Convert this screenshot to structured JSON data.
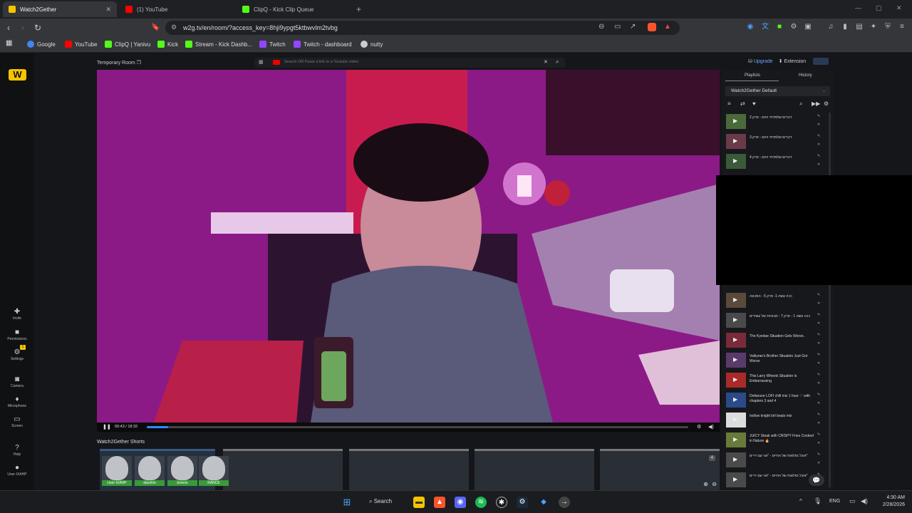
{
  "tabs": [
    {
      "label": "Watch2Gether",
      "active": true,
      "color": "#f5c400"
    },
    {
      "label": "(1) YouTube",
      "active": false,
      "color": "#ff0000"
    },
    {
      "label": "ClipQ - Kick Clip Queue",
      "active": false,
      "color": "#53fc18"
    }
  ],
  "address": {
    "url": "w2g.tv/en/room/?access_key=8hji9ypgt5ktbwvlm2tvbg"
  },
  "bookmarks": [
    {
      "label": "Google",
      "color": "#4285f4"
    },
    {
      "label": "YouTube",
      "color": "#ff0000"
    },
    {
      "label": "ClipQ | Yanivu",
      "color": "#53fc18"
    },
    {
      "label": "Kick",
      "color": "#53fc18"
    },
    {
      "label": "Stream - Kick Dashb...",
      "color": "#53fc18"
    },
    {
      "label": "Twitch",
      "color": "#9146ff"
    },
    {
      "label": "Twitch - dashboard",
      "color": "#9146ff"
    },
    {
      "label": "nutty",
      "color": "#cccccc"
    }
  ],
  "rail": {
    "items": [
      {
        "label": "Invite",
        "icon": "add-user-icon",
        "glyph": "✚"
      },
      {
        "label": "Permissions",
        "icon": "lock-icon",
        "glyph": "🔒"
      },
      {
        "label": "Settings",
        "icon": "gear-icon",
        "glyph": "⚙"
      },
      {
        "label": "Camera",
        "icon": "camera-icon",
        "glyph": "●"
      },
      {
        "label": "Microphone",
        "icon": "microphone-icon",
        "glyph": "🎙"
      },
      {
        "label": "Screen",
        "icon": "screen-icon",
        "glyph": "▭"
      },
      {
        "label": "Help",
        "icon": "help-icon",
        "glyph": "?"
      },
      {
        "label": "User-IXAHP",
        "icon": "user-icon",
        "glyph": "👤"
      }
    ],
    "settings_badge": "1"
  },
  "room": {
    "title": "Temporary Room",
    "search_placeholder": "Search OR Paste a link to a Youtube video",
    "upgrade": "Upgrade",
    "extension": "Extension"
  },
  "player": {
    "time": "00:43 / 18:32",
    "progress": 0.039
  },
  "shorts": {
    "title": "Watch2Gether Shorts",
    "count": "4"
  },
  "users": [
    "User-IXAHP",
    "danshin",
    "korens",
    "RANCE"
  ],
  "playlist": {
    "tabs": [
      "Playlists",
      "History"
    ],
    "selected": "Watch2Gether Default",
    "items_top": [
      {
        "title": "דברים שלמדתי היום - פרק 2",
        "thumb": "#4a6a3a"
      },
      {
        "title": "דברים שלמדתי היום - פרק 3",
        "thumb": "#6a3a4a"
      },
      {
        "title": "דברים שלמדתי היום - פרק 4",
        "thumb": "#3a5a3a"
      }
    ],
    "items_bottom": [
      {
        "title": "ככה עשה 1- פרק 6 - המכונה",
        "thumb": "#5a4a3a"
      },
      {
        "title": "ככה עשה 1 - פרק 7 - מכוניות של עשירים",
        "thumb": "#4a4a4a"
      },
      {
        "title": "The Kyedae Situation Gets Worse..",
        "thumb": "#7a2a3a"
      },
      {
        "title": "Valkyrae's Brother Situation Just Got Worse",
        "thumb": "#5a3a6a"
      },
      {
        "title": "This Larry Wheels Situation Is Embarrassing",
        "thumb": "#aa2a2a"
      },
      {
        "title": "Deltarune LOFI chill mix 1 hour ♡ with chapters 3 and 4",
        "thumb": "#2a4a8a"
      },
      {
        "title": "hollow knight lofi beats mix",
        "thumb": "#dddddd"
      },
      {
        "title": "JUICY Steak with CRISPY Fries Cooked in Nature 🔥",
        "thumb": "#6a7a3a"
      },
      {
        "title": "אוכל נפלאות של החיים - \"אני עם ידיים\"",
        "thumb": "#4a4a4a"
      },
      {
        "title": "אוכל נפלאות של החיים - \"אני עם ידיים\"",
        "thumb": "#4a4a4a"
      }
    ]
  },
  "taskbar": {
    "search": "Search",
    "lang": "ENG",
    "time": "4:30 AM",
    "date": "2/28/2026"
  }
}
